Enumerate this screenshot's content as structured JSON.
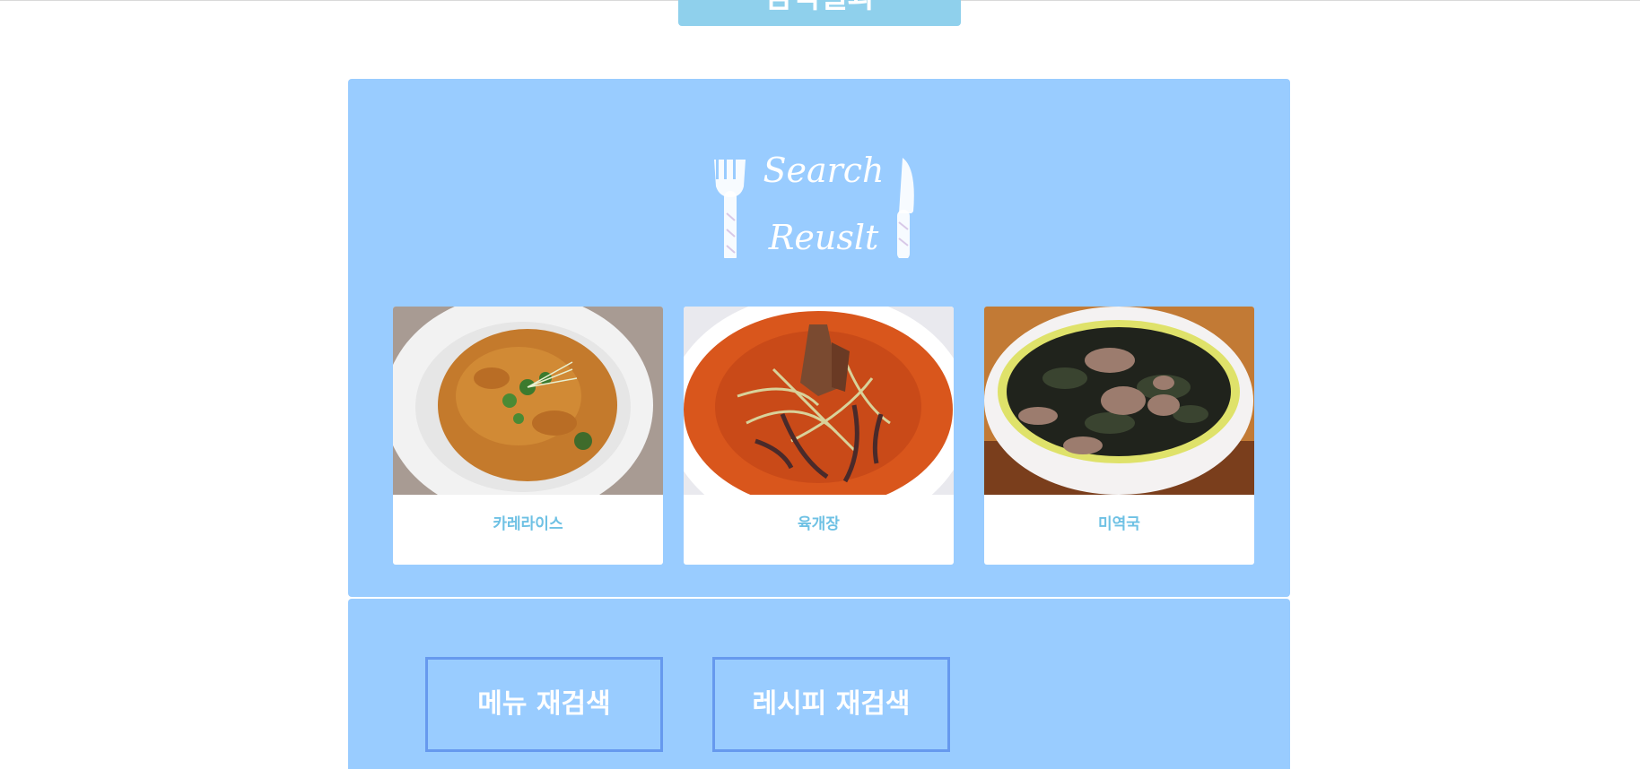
{
  "header": {
    "tab_label": "검색결과"
  },
  "results": {
    "logo_line1": "Search",
    "logo_line2": "Reuslt",
    "cards": [
      {
        "title": "카레라이스",
        "image": "curry-rice-photo"
      },
      {
        "title": "육개장",
        "image": "yukgaejang-photo"
      },
      {
        "title": "미역국",
        "image": "miyeokguk-photo"
      }
    ]
  },
  "actions": {
    "menu_research": "메뉴 재검색",
    "recipe_research": "레시피 재검색"
  },
  "colors": {
    "panel": "#99ccff",
    "tab": "#8fd0ec",
    "card_title": "#6ec1e4",
    "button_border": "#6699ee"
  }
}
